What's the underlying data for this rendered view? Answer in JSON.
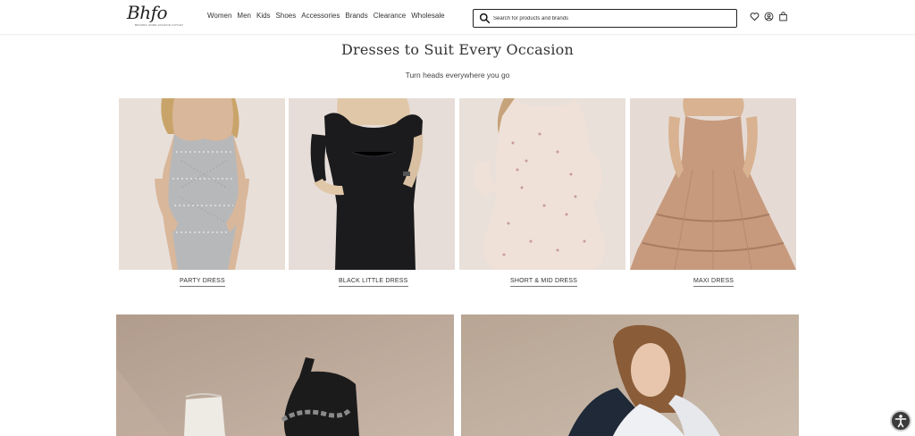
{
  "header": {
    "logo_text": "Bhfo",
    "logo_sub": "BRANDS HOME FASHION OUTLET",
    "nav": [
      "Women",
      "Men",
      "Kids",
      "Shoes",
      "Accessories",
      "Brands",
      "Clearance",
      "Wholesale"
    ],
    "search_placeholder": "Search for products and brands",
    "icons": [
      "heart-icon",
      "user-icon",
      "bag-icon"
    ]
  },
  "section": {
    "title": "Dresses to Suit Every Occasion",
    "subtitle": "Turn heads everywhere you go"
  },
  "categories": [
    {
      "label": "PARTY DRESS"
    },
    {
      "label": "BLACK LITTLE DRESS"
    },
    {
      "label": "SHORT & MID DRESS"
    },
    {
      "label": "MAXI DRESS"
    }
  ],
  "colors": {
    "card_bg": "#e7ddd7",
    "banner_bg": "#b9a493",
    "text": "#222222"
  }
}
